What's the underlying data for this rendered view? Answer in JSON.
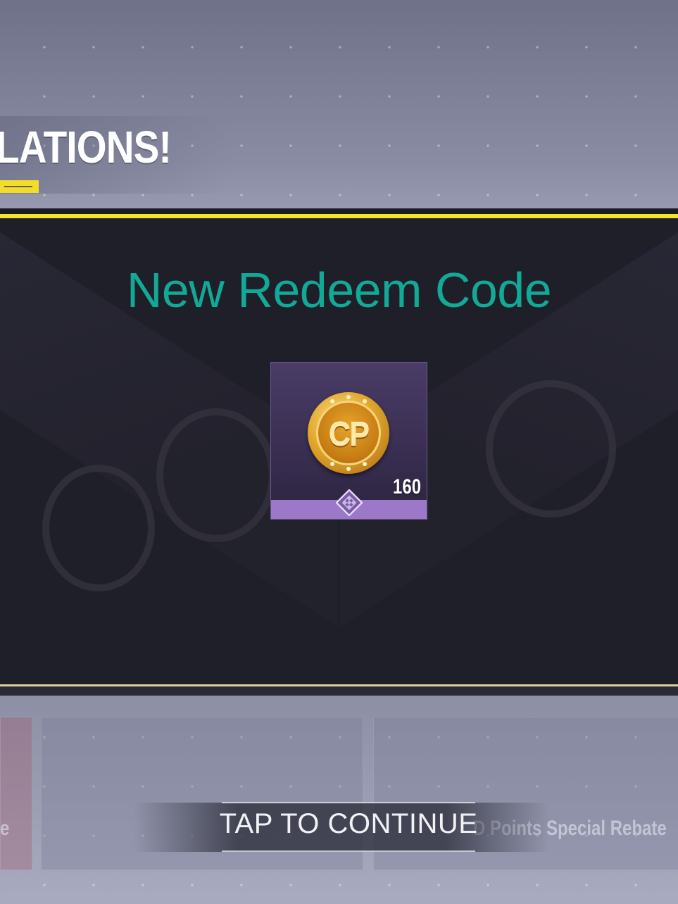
{
  "header": {
    "congrats_text": "LATIONS!"
  },
  "reward": {
    "title": "New Redeem Code",
    "item_icon": "cp-coin-icon",
    "coin_label": "CP",
    "amount": "160",
    "rarity_icon": "rarity-diamond-icon"
  },
  "store": {
    "right_caption": "D Points Special Rebate",
    "left_caption": "e"
  },
  "footer": {
    "tap_label": "TAP TO CONTINUE"
  },
  "colors": {
    "title": "#12a997",
    "accent_yellow": "#f2e52b",
    "rarity_purple": "#9b79c8"
  }
}
